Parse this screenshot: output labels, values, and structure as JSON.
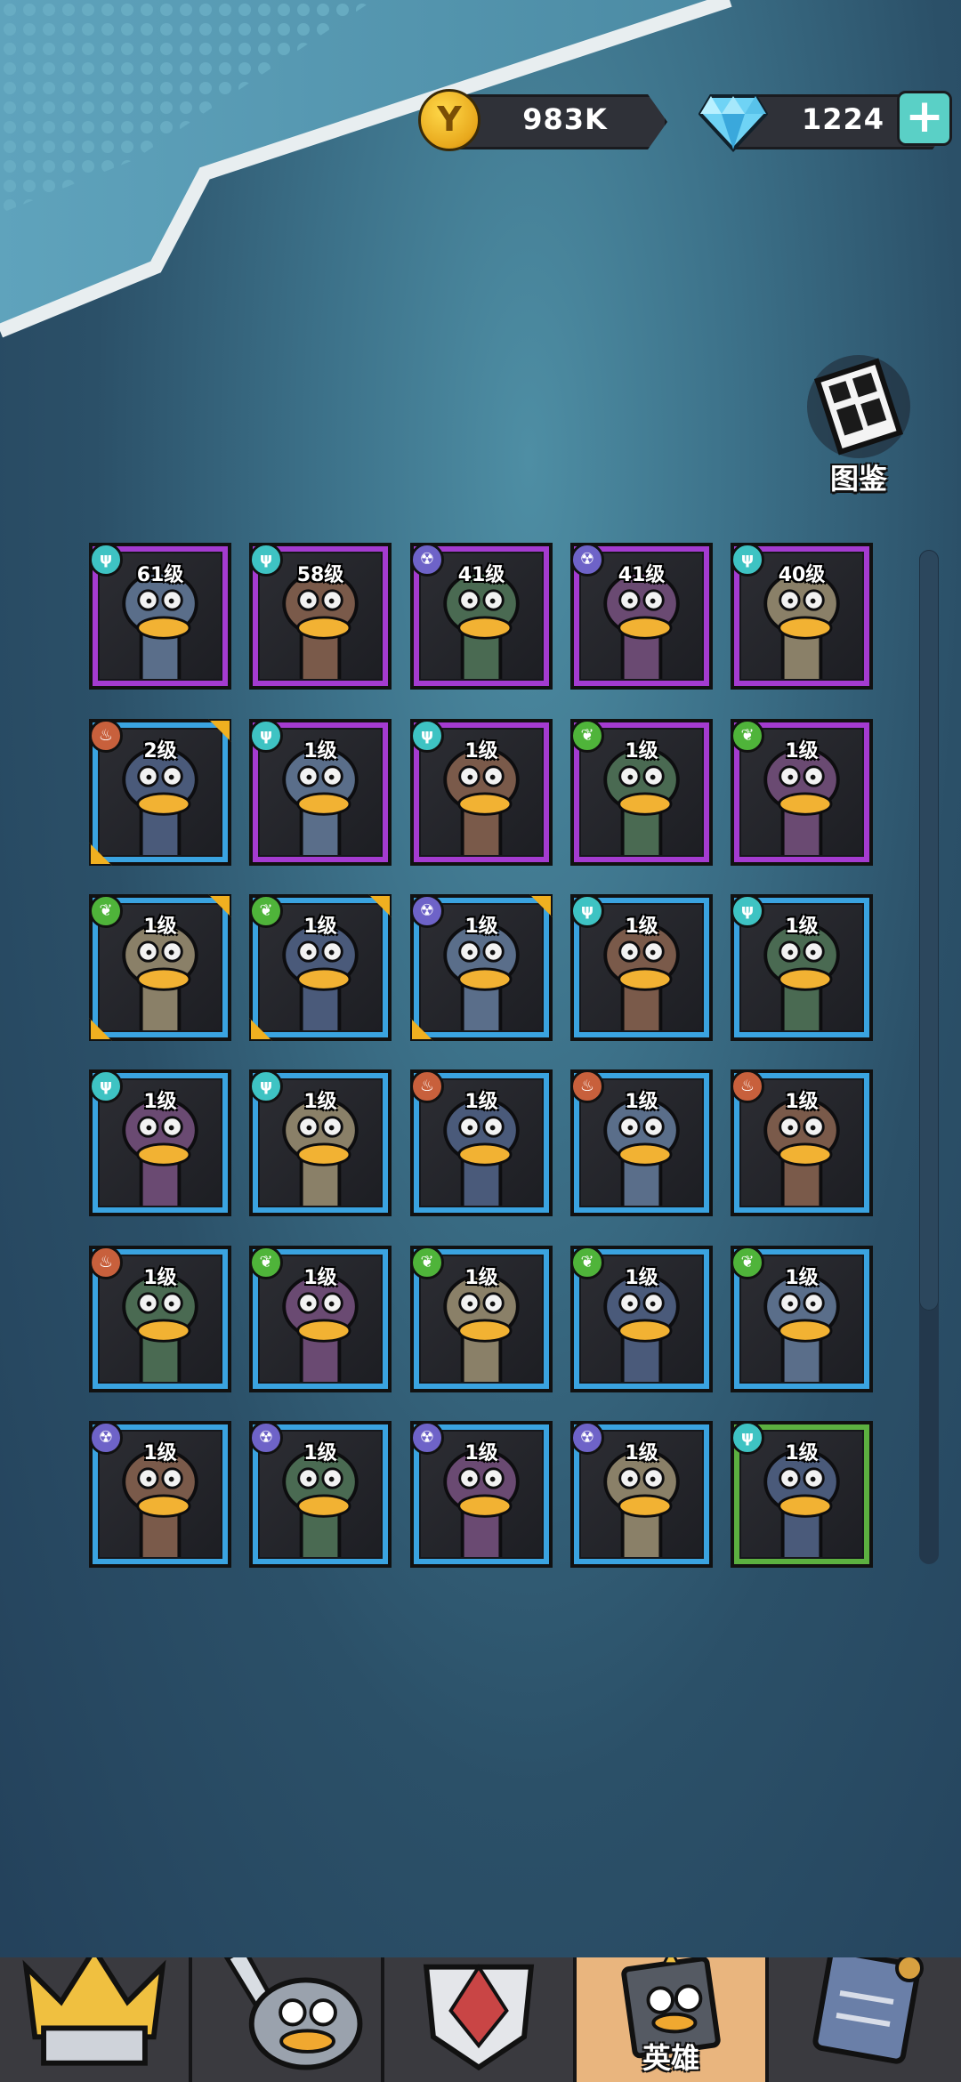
{
  "currency": {
    "coins": {
      "value": "983K",
      "icon": "coin-icon",
      "symbol": "Y"
    },
    "gems": {
      "value": "1224",
      "icon": "diamond-icon",
      "plus": "+"
    }
  },
  "codex": {
    "label": "图鉴",
    "icon": "codex-book-icon"
  },
  "colors": {
    "rare_frame": "#3aa3e0",
    "epic_frame": "#a43bd0",
    "uncommon_frame": "#5cb040",
    "active_tab": "#e9b57e"
  },
  "heroes": [
    {
      "level": "61级",
      "element": "wind",
      "rarity": "purple",
      "corners": false
    },
    {
      "level": "58级",
      "element": "wind",
      "rarity": "purple",
      "corners": false
    },
    {
      "level": "41级",
      "element": "bio",
      "rarity": "purple",
      "corners": false
    },
    {
      "level": "41级",
      "element": "bio",
      "rarity": "purple",
      "corners": false
    },
    {
      "level": "40级",
      "element": "wind",
      "rarity": "purple",
      "corners": false
    },
    {
      "level": "2级",
      "element": "fire",
      "rarity": "blue",
      "corners": true
    },
    {
      "level": "1级",
      "element": "wind",
      "rarity": "purple",
      "corners": false
    },
    {
      "level": "1级",
      "element": "wind",
      "rarity": "purple",
      "corners": false
    },
    {
      "level": "1级",
      "element": "nature",
      "rarity": "purple",
      "corners": false
    },
    {
      "level": "1级",
      "element": "nature",
      "rarity": "purple",
      "corners": false
    },
    {
      "level": "1级",
      "element": "nature",
      "rarity": "blue",
      "corners": true
    },
    {
      "level": "1级",
      "element": "nature",
      "rarity": "blue",
      "corners": true
    },
    {
      "level": "1级",
      "element": "bio",
      "rarity": "blue",
      "corners": true
    },
    {
      "level": "1级",
      "element": "wind",
      "rarity": "blue",
      "corners": false
    },
    {
      "level": "1级",
      "element": "wind",
      "rarity": "blue",
      "corners": false
    },
    {
      "level": "1级",
      "element": "wind",
      "rarity": "blue",
      "corners": false
    },
    {
      "level": "1级",
      "element": "wind",
      "rarity": "blue",
      "corners": false
    },
    {
      "level": "1级",
      "element": "fire",
      "rarity": "blue",
      "corners": false
    },
    {
      "level": "1级",
      "element": "fire",
      "rarity": "blue",
      "corners": false
    },
    {
      "level": "1级",
      "element": "fire",
      "rarity": "blue",
      "corners": false
    },
    {
      "level": "1级",
      "element": "fire",
      "rarity": "blue",
      "corners": false
    },
    {
      "level": "1级",
      "element": "nature",
      "rarity": "blue",
      "corners": false
    },
    {
      "level": "1级",
      "element": "nature",
      "rarity": "blue",
      "corners": false
    },
    {
      "level": "1级",
      "element": "nature",
      "rarity": "blue",
      "corners": false
    },
    {
      "level": "1级",
      "element": "nature",
      "rarity": "blue",
      "corners": false
    },
    {
      "level": "1级",
      "element": "bio",
      "rarity": "blue",
      "corners": false
    },
    {
      "level": "1级",
      "element": "bio",
      "rarity": "blue",
      "corners": false
    },
    {
      "level": "1级",
      "element": "bio",
      "rarity": "blue",
      "corners": false
    },
    {
      "level": "1级",
      "element": "bio",
      "rarity": "blue",
      "corners": false
    },
    {
      "level": "1级",
      "element": "wind",
      "rarity": "green",
      "corners": false
    }
  ],
  "nav": {
    "tabs": [
      {
        "name": "tab-crown",
        "icon": "crown-castle-icon",
        "label": ""
      },
      {
        "name": "tab-battle",
        "icon": "duck-sword-icon",
        "label": ""
      },
      {
        "name": "tab-equipment",
        "icon": "armor-shield-icon",
        "label": ""
      },
      {
        "name": "tab-heroes",
        "icon": "duck-book-icon",
        "label": "英雄",
        "active": true
      },
      {
        "name": "tab-quests",
        "icon": "scroll-icon",
        "label": ""
      }
    ]
  }
}
